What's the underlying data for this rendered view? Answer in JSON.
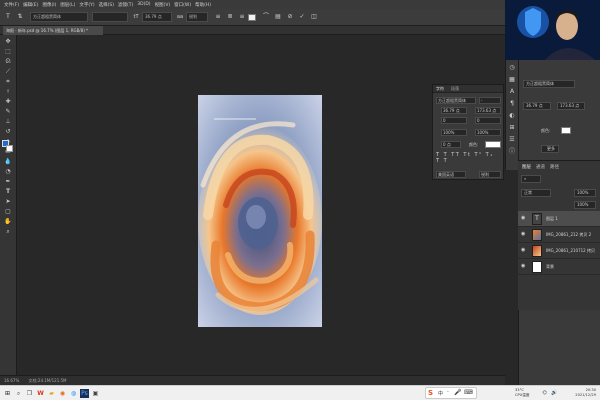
{
  "menubar": {
    "items": [
      "文件(F)",
      "编辑(E)",
      "图像(I)",
      "图层(L)",
      "文字(Y)",
      "选择(S)",
      "滤镜(T)",
      "3D(D)",
      "视图(V)",
      "窗口(W)",
      "帮助(H)"
    ]
  },
  "options": {
    "font_family": "方正超粗黑简体",
    "font_size": "36.79 点",
    "antialias": "锐利"
  },
  "document_tab": {
    "title": "海报 · 新年.psd @ 16.7% (图层 1, RGB/8) *"
  },
  "statusbar": {
    "zoom": "16.67%",
    "doc_info": "文档:24.1M/121.5M"
  },
  "character_panel": {
    "tabs": [
      "字符",
      "段落"
    ],
    "font": "方正超粗黑简体",
    "style": "-",
    "size": "36.79 点",
    "leading": "173.63 点",
    "kerning": "0",
    "tracking": "0",
    "vscale": "100%",
    "hscale": "100%",
    "baseline": "0 点",
    "color_label": "颜色:",
    "lang": "美国英语",
    "aa": "锐利"
  },
  "properties": {
    "font": "方正超粗黑简体",
    "size": "36.79 点",
    "leading": "173.63 点",
    "color_label": "颜色:",
    "button": "更多"
  },
  "layers": {
    "tabs": [
      "图层",
      "通道",
      "路径"
    ],
    "blend": "正常",
    "opacity": "100%",
    "fill": "100%",
    "items": [
      {
        "name": "图层 1",
        "type": "text"
      },
      {
        "name": "IMG_20861_212 拷贝 2",
        "type": "image"
      },
      {
        "name": "IMG_20861_210712 拷贝",
        "type": "image"
      },
      {
        "name": "背景",
        "type": "bg"
      }
    ]
  },
  "taskbar": {
    "temp": "33°C",
    "cpu": "CPU温度",
    "time": "20:30",
    "date": "2021/12/29"
  },
  "colors": {
    "accent_blue": "#1f6bd6",
    "panel_bg": "#3a3a3a",
    "canvas_bg": "#282828"
  }
}
